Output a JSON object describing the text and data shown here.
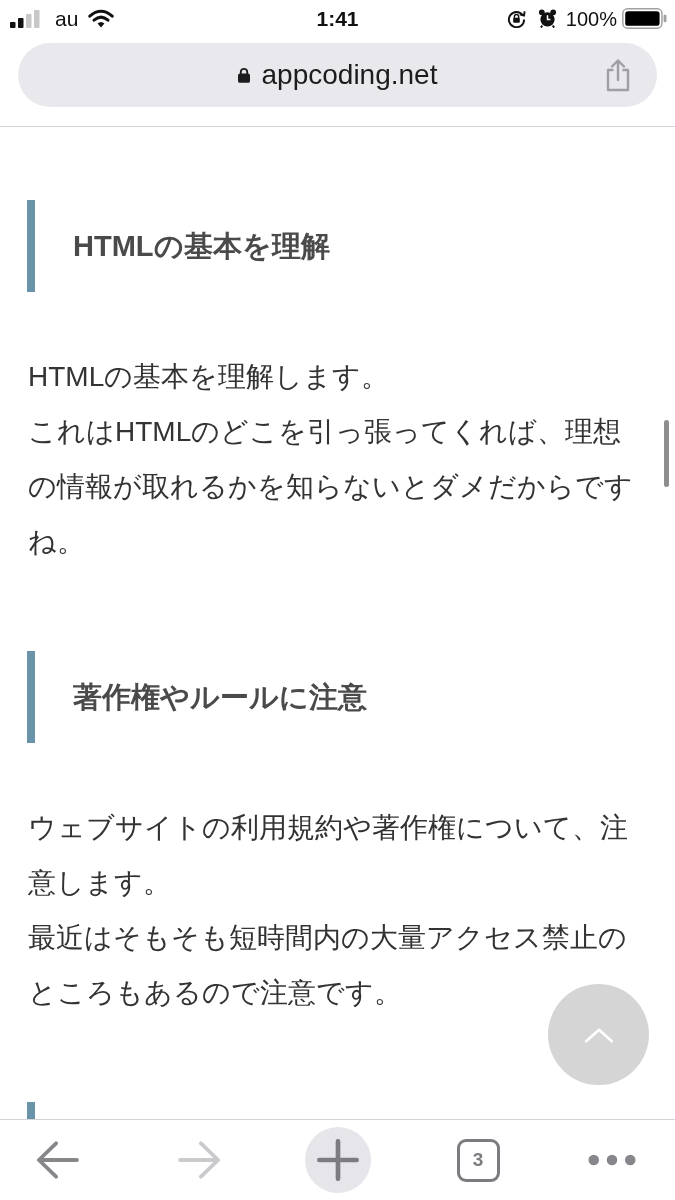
{
  "status_bar": {
    "carrier": "au",
    "time": "1:41",
    "battery": "100%"
  },
  "address_bar": {
    "url": "appcoding.net"
  },
  "article": {
    "sections": [
      {
        "heading": "HTMLの基本を理解",
        "paragraph": [
          "HTMLの基本を理解します。",
          "これはHTMLのどこを引っ張ってくれば、理想の情報が取れるかを知らないとダメだからですね。"
        ]
      },
      {
        "heading": "著作権やルールに注意",
        "paragraph": [
          "ウェブサイトの利用規約や著作権について、注意します。",
          "最近はそもそも短時間内の大量アクセス禁止のところもあるので注意です。"
        ]
      }
    ],
    "more_below": true
  },
  "toolbar": {
    "buttons": [
      {
        "kind": "back",
        "disabled": false
      },
      {
        "kind": "forward",
        "disabled": true
      },
      {
        "kind": "new-tab",
        "disabled": false
      },
      {
        "kind": "tabs",
        "label": "3",
        "disabled": false
      },
      {
        "kind": "more",
        "disabled": false
      }
    ]
  }
}
